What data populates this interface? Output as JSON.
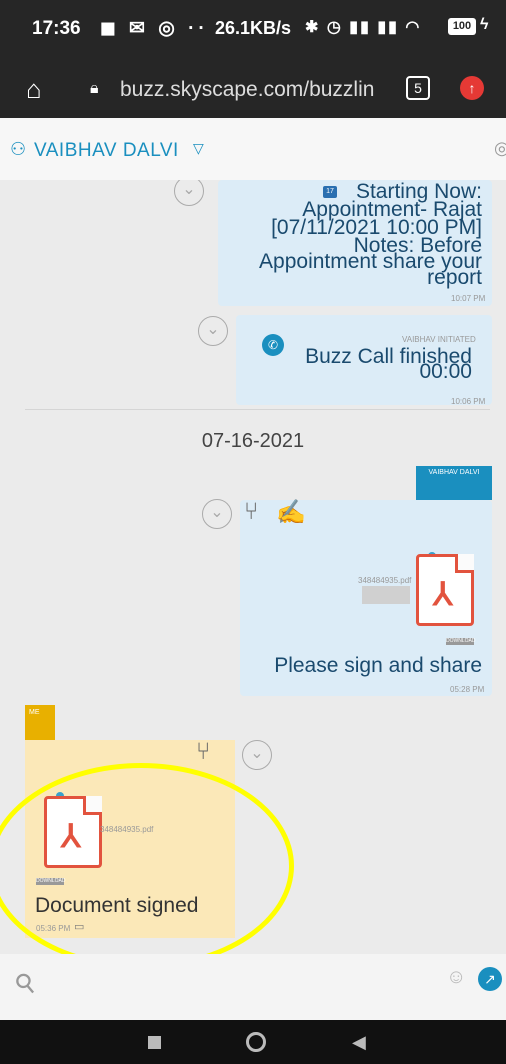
{
  "statusbar": {
    "time": "17:36",
    "net_speed": "26.1KB/s",
    "battery": "100"
  },
  "browser": {
    "url": "buzz.skyscape.com/buzzlin",
    "tab_count": "5"
  },
  "chat_header": {
    "user_name": "VAIBHAV DALVI"
  },
  "messages": {
    "appointment": {
      "line1": "Starting Now:",
      "line2": "Appointment- Rajat",
      "line3": "[07/11/2021 10:00 PM]",
      "line4": "Notes: Before",
      "line5": "Appointment share your",
      "line6": "report",
      "calendar_day": "17",
      "time": "10:07 PM"
    },
    "call": {
      "initiated_label": "VAIBHAV INITIATED",
      "title": "Buzz Call finished",
      "duration": "00:00",
      "time": "10:06 PM"
    },
    "date_separator": "07-16-2021",
    "outgoing_doc": {
      "sender": "VAIBHAV DALVI",
      "file_name": "348484935.pdf",
      "download_label": "DOWNLOAD",
      "text": "Please sign and share",
      "time": "05:28 PM"
    },
    "incoming_doc": {
      "sender_tag": "ME",
      "file_name": "348484935.pdf",
      "download_label": "DOWNLOAD",
      "text": "Document signed",
      "time": "05:36 PM"
    }
  },
  "icons": [
    "home-icon",
    "lock-icon",
    "tabs-icon",
    "upload-icon",
    "users-icon",
    "chevron-down-icon",
    "calendar-icon",
    "phone-icon",
    "branch-icon",
    "edit-sign-icon",
    "pdf-icon",
    "comment-icon",
    "paperclip-icon",
    "emoji-icon",
    "send-icon"
  ],
  "colors": {
    "accent": "#1a8fbf",
    "outgoing_bubble": "#dcecf7",
    "incoming_bubble": "#fbe8b8",
    "highlight": "#ffff00",
    "pdf_red": "#e2533e"
  }
}
